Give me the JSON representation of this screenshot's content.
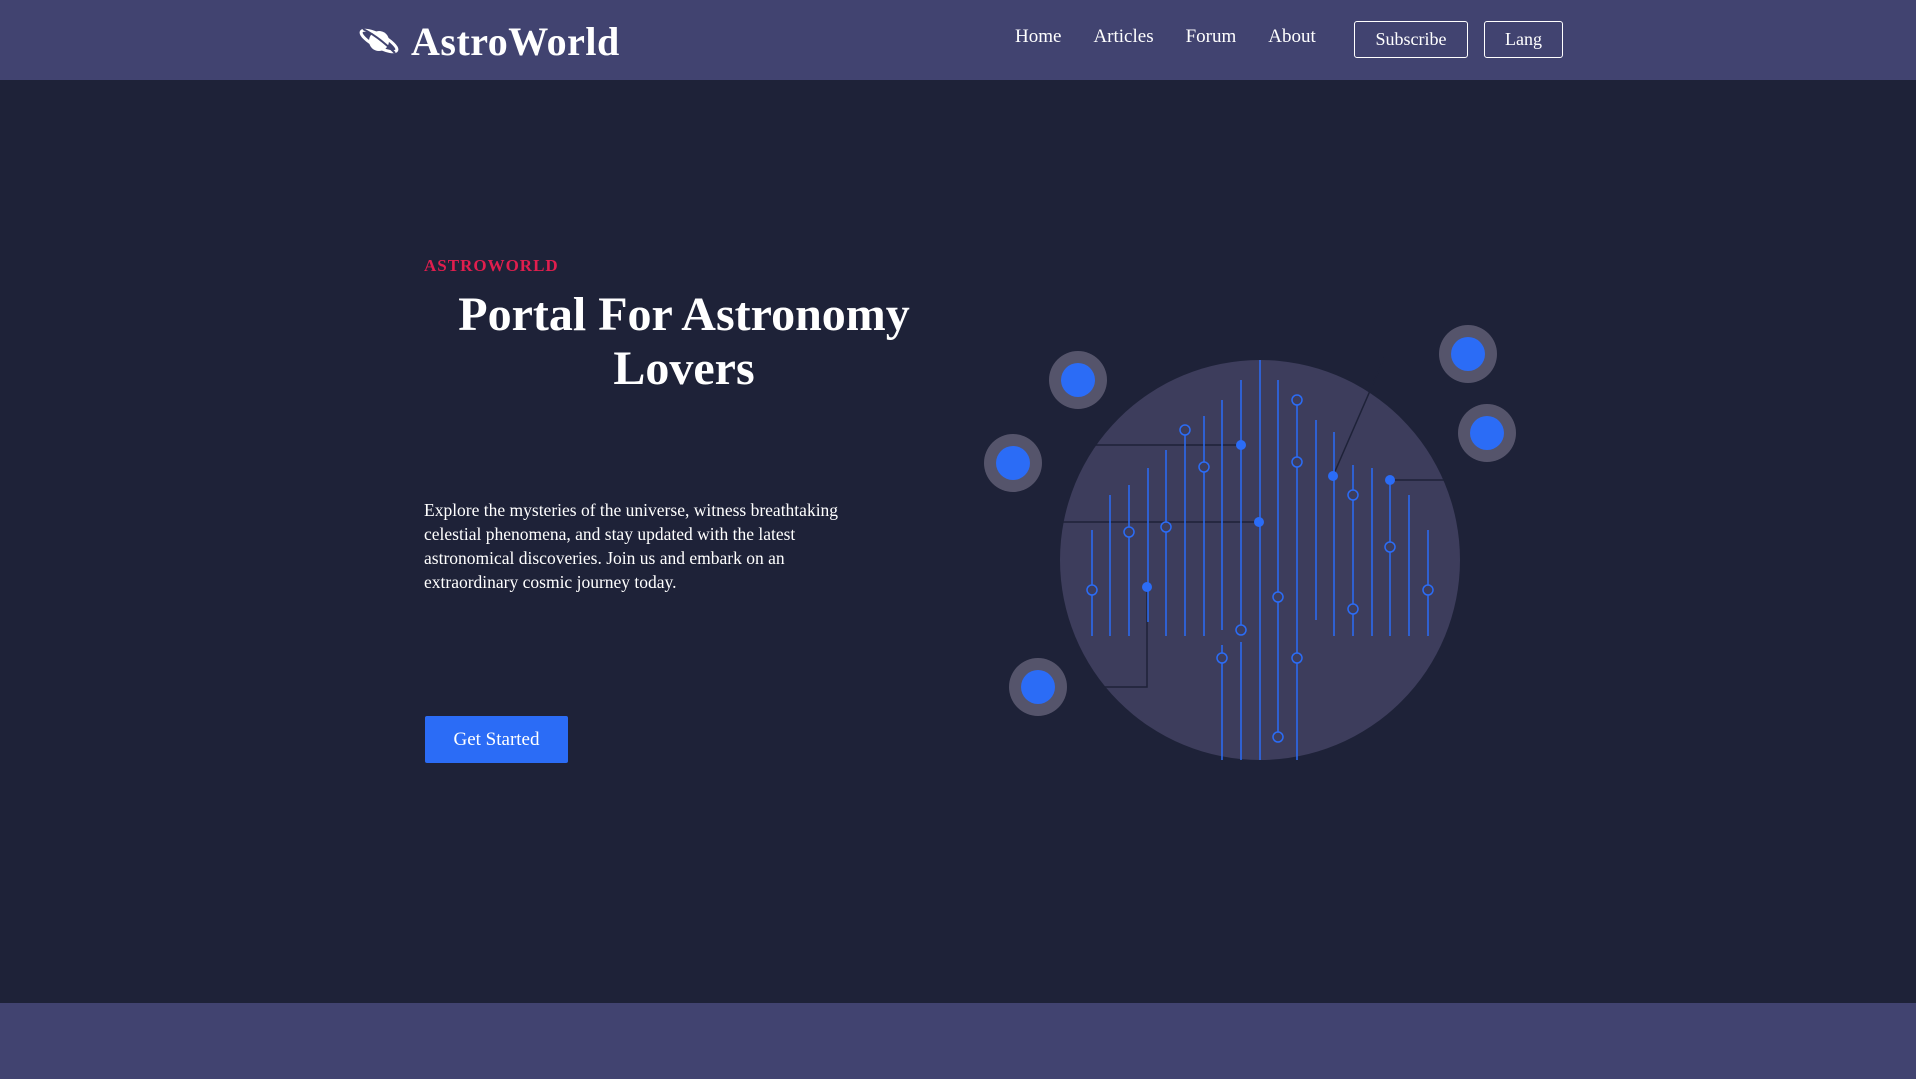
{
  "header": {
    "brand": "AstroWorld",
    "logo_icon": "planet-icon",
    "nav": [
      "Home",
      "Articles",
      "Forum",
      "About"
    ],
    "subscribe_label": "Subscribe",
    "lang_label": "Lang"
  },
  "hero": {
    "eyebrow": "ASTROWORLD",
    "title_line1": "Portal For Astronomy",
    "title_line2": "Lovers",
    "description": "Explore the mysteries of the universe, witness breathtaking celestial phenomena, and stay updated with the latest astronomical discoveries. Join us and embark on an extraordinary cosmic journey today.",
    "cta_label": "Get Started",
    "illustration_icon": "circuit-planet-illustration"
  },
  "colors": {
    "header_bg": "#414370",
    "page_bg": "#1e2238",
    "accent": "#2b6cf6",
    "eyebrow": "#e01e4e"
  }
}
